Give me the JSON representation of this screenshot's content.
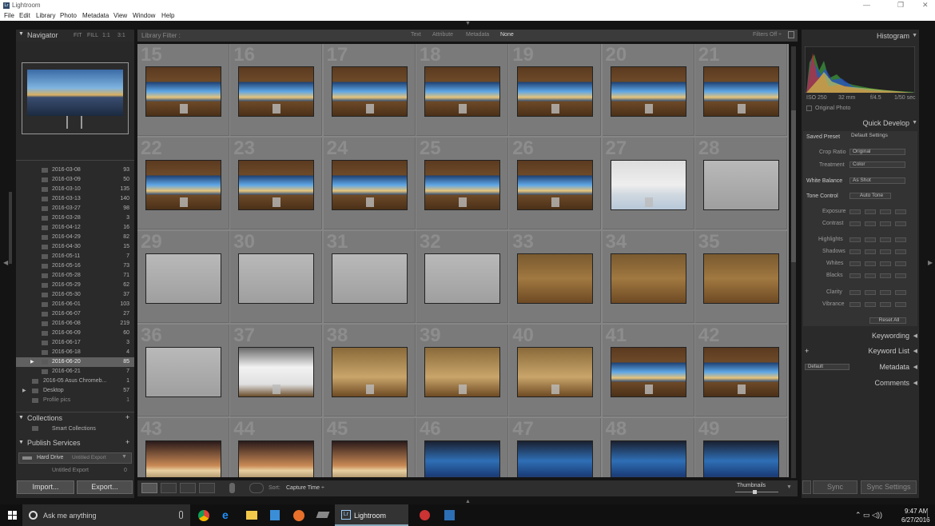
{
  "window": {
    "title": "Lightroom",
    "minimize": "—",
    "restore": "❐",
    "close": "✕"
  },
  "menu": [
    "File",
    "Edit",
    "Library",
    "Photo",
    "Metadata",
    "View",
    "Window",
    "Help"
  ],
  "navigator": {
    "title": "Navigator",
    "zoom": [
      "FIT",
      "FILL",
      "1:1",
      "3:1"
    ]
  },
  "folders": [
    {
      "name": "2016-03-08",
      "count": "93"
    },
    {
      "name": "2016-03-09",
      "count": "50"
    },
    {
      "name": "2016-03-10",
      "count": "135"
    },
    {
      "name": "2016-03-13",
      "count": "140"
    },
    {
      "name": "2016-03-27",
      "count": "98"
    },
    {
      "name": "2016-03-28",
      "count": "3"
    },
    {
      "name": "2016-04-12",
      "count": "16"
    },
    {
      "name": "2016-04-29",
      "count": "82"
    },
    {
      "name": "2016-04-30",
      "count": "15"
    },
    {
      "name": "2016-05-11",
      "count": "7"
    },
    {
      "name": "2016-05-16",
      "count": "73"
    },
    {
      "name": "2016-05-28",
      "count": "71"
    },
    {
      "name": "2016-05-29",
      "count": "62"
    },
    {
      "name": "2016-05-30",
      "count": "37"
    },
    {
      "name": "2016-06-01",
      "count": "103"
    },
    {
      "name": "2016-06-07",
      "count": "27"
    },
    {
      "name": "2016-06-08",
      "count": "219"
    },
    {
      "name": "2016-06-09",
      "count": "60"
    },
    {
      "name": "2016-06-17",
      "count": "3"
    },
    {
      "name": "2016-06-18",
      "count": "4"
    },
    {
      "name": "2016-06-20",
      "count": "85"
    },
    {
      "name": "2016-06-21",
      "count": "7"
    }
  ],
  "other_folders": [
    {
      "name": "2016-05 Asus Chromeb...",
      "count": "1"
    },
    {
      "name": "Desktop",
      "count": "57"
    },
    {
      "name": "Profile pics",
      "count": "1"
    }
  ],
  "collections": {
    "title": "Collections",
    "add": "+",
    "smart": "Smart Collections"
  },
  "publish": {
    "title": "Publish Services",
    "add": "+",
    "service": "Hard Drive",
    "sub": "Untitled Export",
    "sub2": "Untitled Export",
    "sub2count": "0"
  },
  "left_buttons": {
    "import": "Import...",
    "export": "Export..."
  },
  "filter": {
    "label": "Library Filter :",
    "options": [
      "Text",
      "Attribute",
      "Metadata",
      "None"
    ],
    "filters_off": "Filters Off ÷"
  },
  "grid_numbers": [
    "15",
    "16",
    "17",
    "18",
    "19",
    "20",
    "21",
    "22",
    "23",
    "24",
    "25",
    "26",
    "27",
    "28",
    "29",
    "30",
    "31",
    "32",
    "33",
    "34",
    "35",
    "36",
    "37",
    "38",
    "39",
    "40",
    "41",
    "42",
    "43",
    "44",
    "45",
    "46",
    "47",
    "48",
    "49"
  ],
  "toolbar": {
    "sort_label": "Sort:",
    "sort_value": "Capture Time ÷",
    "thumbnails": "Thumbnails"
  },
  "right": {
    "histogram": "Histogram",
    "iso": "ISO 250",
    "mm": "32 mm",
    "fstop": "f/4.5",
    "shutter": "1/50 sec",
    "original_photo": "Original Photo",
    "quick_develop": "Quick Develop",
    "saved_preset": "Saved Preset",
    "saved_preset_value": "Default Settings",
    "crop_ratio": "Crop Ratio",
    "crop_ratio_value": "Original",
    "treatment": "Treatment",
    "treatment_value": "Color",
    "white_balance": "White Balance",
    "white_balance_value": "As Shot",
    "tone_control": "Tone Control",
    "auto_tone": "Auto Tone",
    "sliders": [
      "Exposure",
      "Contrast",
      "Highlights",
      "Shadows",
      "Whites",
      "Blacks",
      "Clarity",
      "Vibrance"
    ],
    "reset": "Reset All",
    "keywording": "Keywording",
    "keyword_list": "Keyword List",
    "plus": "+",
    "metadata": "Metadata",
    "metadata_preset": "Default",
    "comments": "Comments"
  },
  "sync": {
    "sync": "Sync",
    "sync_settings": "Sync Settings"
  },
  "taskbar": {
    "search": "Ask me anything",
    "app": "Lightroom",
    "time": "9:47 AM",
    "date": "6/27/2016"
  }
}
